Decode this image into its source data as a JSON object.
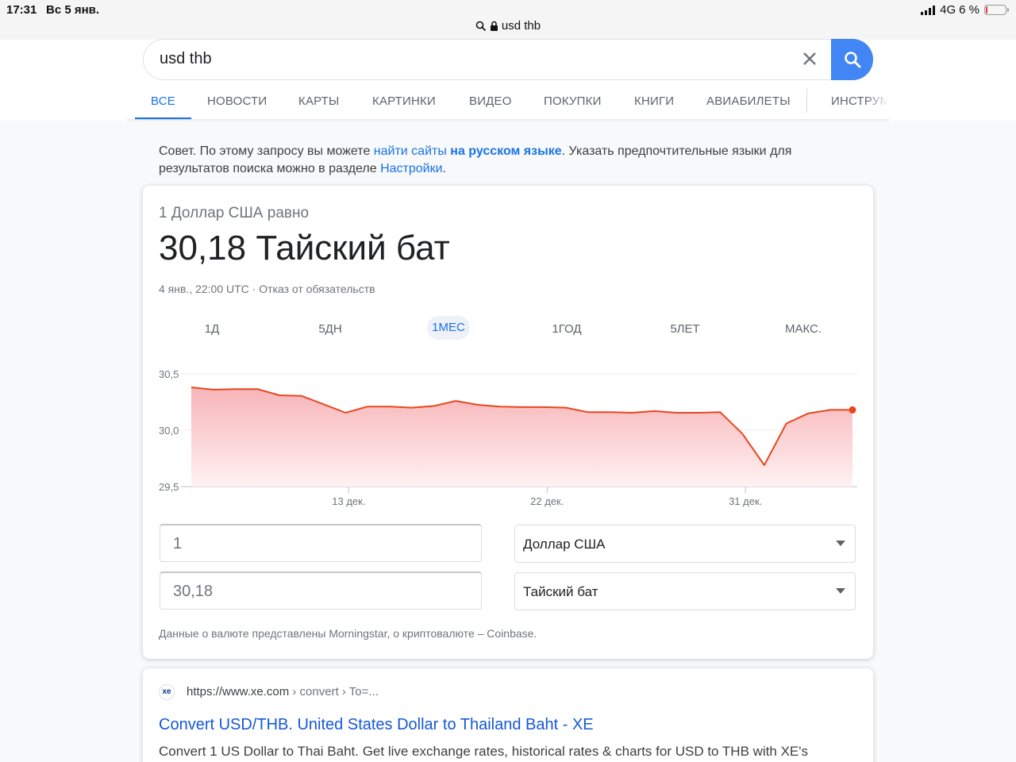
{
  "status_bar": {
    "time": "17:31",
    "date": "Вс 5 янв.",
    "network": "4G",
    "battery": "6 %",
    "battery_level": 0.06,
    "url": "usd thb"
  },
  "search": {
    "query": "usd thb"
  },
  "tabs": [
    {
      "label": "ВСЕ",
      "active": true
    },
    {
      "label": "НОВОСТИ"
    },
    {
      "label": "КАРТЫ"
    },
    {
      "label": "КАРТИНКИ"
    },
    {
      "label": "ВИДЕО"
    },
    {
      "label": "ПОКУПКИ"
    },
    {
      "label": "КНИГИ"
    },
    {
      "label": "АВИАБИЛЕТЫ"
    },
    {
      "label": "ИНСТРУМ"
    }
  ],
  "tip": {
    "prefix": "Совет. По этому запросу вы можете ",
    "link1": "найти сайты",
    "link1_bold": "на русском языке",
    "middle": ". Указать предпочтительные языки для результатов поиска можно в разделе ",
    "link2": "Настройки",
    "suffix": "."
  },
  "converter": {
    "label": "1 Доллар США равно",
    "value": "30,18 Тайский бат",
    "meta": "4 янв., 22:00 UTC · Отказ от обязательств",
    "ranges": [
      "1Д",
      "5ДН",
      "1МЕС",
      "1ГОД",
      "5ЛЕТ",
      "МАКС."
    ],
    "active_range": "1МЕС",
    "amount_from": "1",
    "amount_to": "30,18",
    "currency_from": "Доллар США",
    "currency_to": "Тайский бат",
    "disclaimer": "Данные о валюте представлены Morningstar, о криптовалюте – Coinbase."
  },
  "chart_data": {
    "type": "area",
    "ylim": [
      29.5,
      30.5
    ],
    "y_ticks": [
      "30,5",
      "30,0",
      "29,5"
    ],
    "x_ticks": [
      "13 дек.",
      "22 дек.",
      "31 дек."
    ],
    "grid": true,
    "colors": {
      "line": "#e8471e",
      "fill_top": "#f7b4b8",
      "fill_bottom": "#fff1f2"
    },
    "series": [
      {
        "values": [
          30.38,
          30.36,
          30.365,
          30.365,
          30.31,
          30.305,
          30.23,
          30.155,
          30.21,
          30.21,
          30.2,
          30.215,
          30.26,
          30.225,
          30.21,
          30.205,
          30.205,
          30.2,
          30.16,
          30.16,
          30.155,
          30.17,
          30.155,
          30.155,
          30.16,
          29.97,
          29.69,
          30.06,
          30.15,
          30.18,
          30.18
        ]
      }
    ]
  },
  "result": {
    "favicon_text": "xe",
    "url": "https://www.xe.com",
    "breadcrumbs": " › convert › To=...",
    "title": "Convert USD/THB. United States Dollar to Thailand Baht - XE",
    "snippet": "Convert 1 US Dollar to Thai Baht. Get live exchange rates, historical rates & charts for USD to THB with XE's"
  }
}
